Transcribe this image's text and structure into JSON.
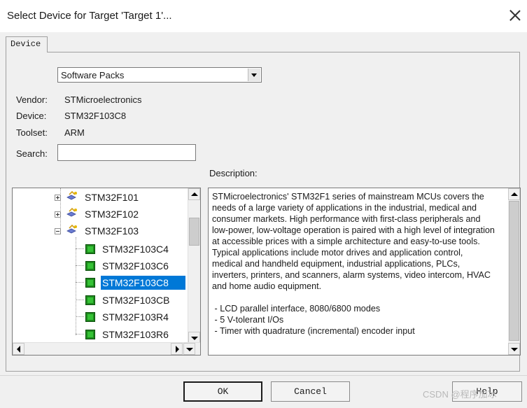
{
  "window": {
    "title": "Select Device for Target 'Target 1'..."
  },
  "tabs": [
    {
      "label": "Device"
    }
  ],
  "pack_select": {
    "value": "Software Packs"
  },
  "info": {
    "vendor_label": "Vendor:",
    "vendor": "STMicroelectronics",
    "device_label": "Device:",
    "device": "STM32F103C8",
    "toolset_label": "Toolset:",
    "toolset": "ARM",
    "search_label": "Search:",
    "search_value": ""
  },
  "description_label": "Description:",
  "tree": {
    "families": [
      {
        "label": "STM32F101",
        "expanded": false
      },
      {
        "label": "STM32F102",
        "expanded": false
      },
      {
        "label": "STM32F103",
        "expanded": true
      }
    ],
    "devices": [
      {
        "label": "STM32F103C4",
        "selected": false
      },
      {
        "label": "STM32F103C6",
        "selected": false
      },
      {
        "label": "STM32F103C8",
        "selected": true
      },
      {
        "label": "STM32F103CB",
        "selected": false
      },
      {
        "label": "STM32F103R4",
        "selected": false
      },
      {
        "label": "STM32F103R6",
        "selected": false
      }
    ]
  },
  "description": "STMicroelectronics' STM32F1 series of mainstream MCUs covers the needs of a large variety of applications in the industrial, medical and consumer markets. High performance with first-class peripherals and low-power, low-voltage operation is paired with a high level of integration at accessible prices with a simple architecture and easy-to-use tools.\nTypical applications include motor drives and application control, medical and handheld equipment, industrial applications, PLCs, inverters, printers, and scanners, alarm systems, video intercom, HVAC and home audio equipment.\n\n - LCD parallel interface, 8080/6800 modes\n - 5 V-tolerant I/Os\n - Timer with quadrature (incremental) encoder input",
  "buttons": {
    "ok": "OK",
    "cancel": "Cancel",
    "help": "Help"
  },
  "watermark": "CSDN @程序加冰",
  "colors": {
    "selection": "#0078d7",
    "chip": "#1d8a1d"
  }
}
